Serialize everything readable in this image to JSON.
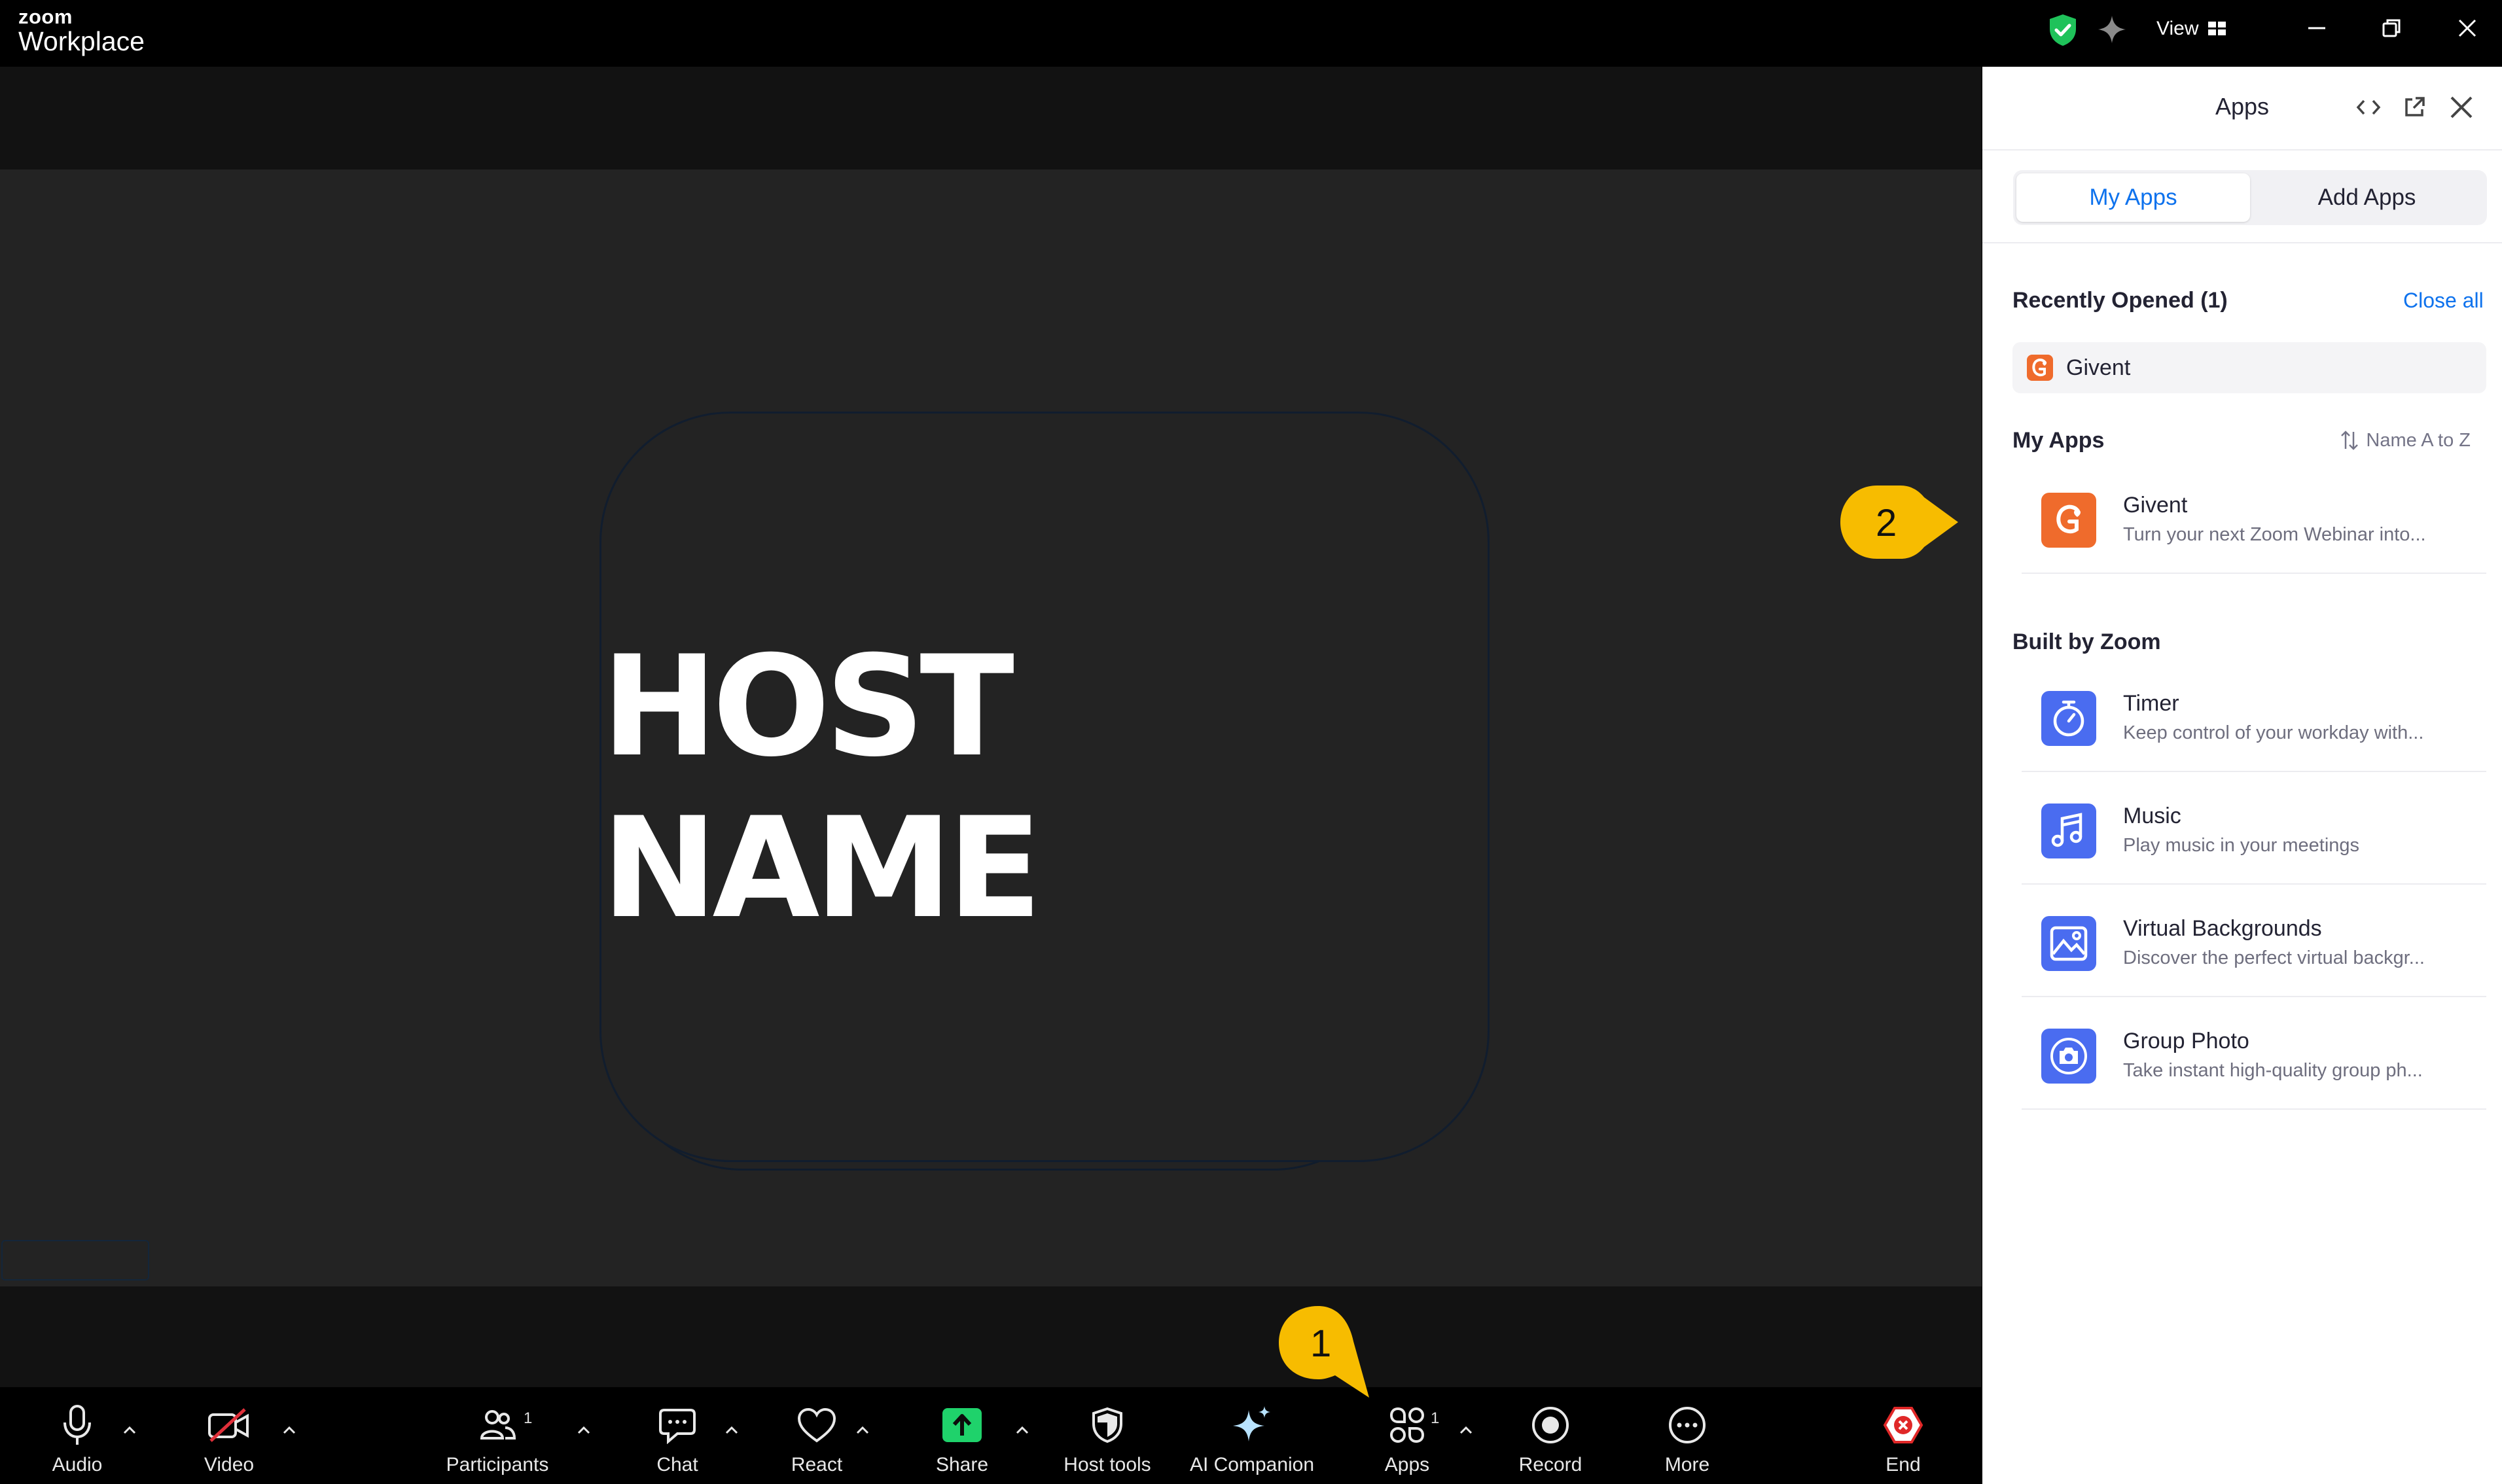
{
  "app": {
    "brand_top": "zoom",
    "brand_bottom": "Workplace"
  },
  "titlebar": {
    "view_label": "View"
  },
  "stage": {
    "host_name": "HOST NAME"
  },
  "toolbar": {
    "audio": "Audio",
    "video": "Video",
    "participants": "Participants",
    "participants_count": "1",
    "chat": "Chat",
    "react": "React",
    "share": "Share",
    "host_tools": "Host tools",
    "ai_companion": "AI Companion",
    "apps": "Apps",
    "apps_count": "1",
    "record": "Record",
    "more": "More",
    "end": "End"
  },
  "colors": {
    "accent": "#0e72ed",
    "share_green": "#1fd26b",
    "end_red": "#e02828",
    "callout_yellow": "#f7bc00",
    "shield_green": "#1fc25a"
  },
  "panel": {
    "title": "Apps",
    "tabs": [
      {
        "label": "My Apps",
        "active": true
      },
      {
        "label": "Add Apps",
        "active": false
      }
    ],
    "recent": {
      "title": "Recently Opened (1)",
      "close_all": "Close all",
      "items": [
        {
          "name": "Givent",
          "icon": "givent-icon"
        }
      ]
    },
    "my_apps": {
      "title": "My Apps",
      "sort_label": "Name A to Z",
      "items": [
        {
          "name": "Givent",
          "desc": "Turn your next Zoom Webinar into...",
          "icon": "givent-icon"
        }
      ]
    },
    "built_by_zoom": {
      "title": "Built by Zoom",
      "items": [
        {
          "name": "Timer",
          "desc": "Keep control of your workday with...",
          "icon": "timer-icon"
        },
        {
          "name": "Music",
          "desc": "Play music in your meetings",
          "icon": "music-icon"
        },
        {
          "name": "Virtual Backgrounds",
          "desc": "Discover the perfect virtual backgr...",
          "icon": "image-icon"
        },
        {
          "name": "Group Photo",
          "desc": "Take instant high-quality group ph...",
          "icon": "camera-icon"
        }
      ]
    }
  },
  "callouts": [
    {
      "number": "1"
    },
    {
      "number": "2"
    }
  ]
}
